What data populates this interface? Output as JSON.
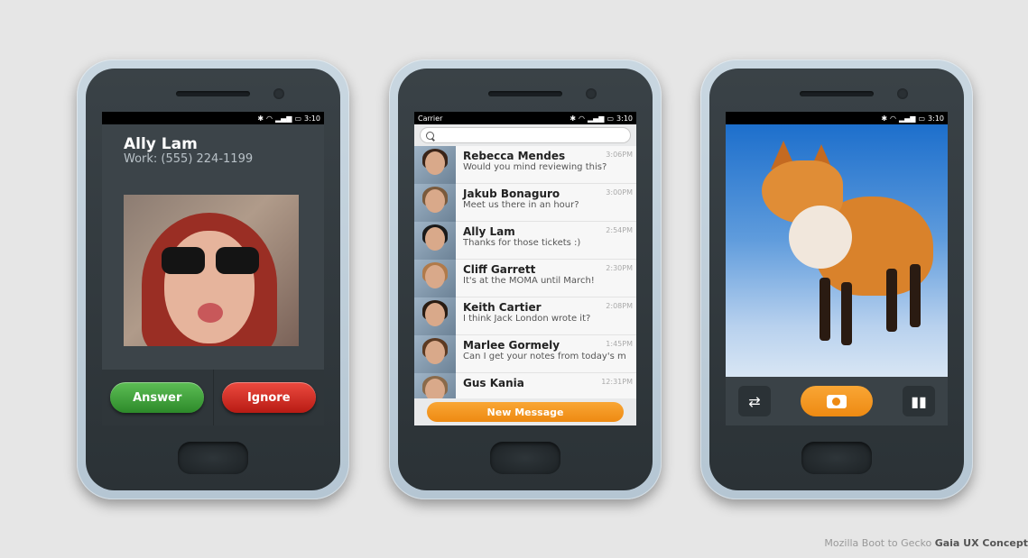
{
  "status": {
    "time": "3:10",
    "carrier": "Carrier",
    "icons": [
      "bluetooth-icon",
      "wifi-icon",
      "signal-icon",
      "battery-icon"
    ]
  },
  "call": {
    "caller_name": "Ally Lam",
    "caller_number": "Work: (555) 224-1199",
    "answer_label": "Answer",
    "ignore_label": "Ignore",
    "answer_color": "#2d8a2a",
    "ignore_color": "#b81b14"
  },
  "messages": {
    "items": [
      {
        "name": "Rebecca Mendes",
        "preview": "Would you mind reviewing this?",
        "time": "3:06PM"
      },
      {
        "name": "Jakub Bonaguro",
        "preview": "Meet us there in an hour?",
        "time": "3:00PM"
      },
      {
        "name": "Ally Lam",
        "preview": "Thanks for those tickets :)",
        "time": "2:54PM"
      },
      {
        "name": "Cliff Garrett",
        "preview": "It's at the MOMA until March!",
        "time": "2:30PM"
      },
      {
        "name": "Keith Cartier",
        "preview": "I think Jack London wrote it?",
        "time": "2:08PM"
      },
      {
        "name": "Marlee Gormely",
        "preview": "Can I get your notes from today's m",
        "time": "1:45PM"
      },
      {
        "name": "Gus Kania",
        "preview": "",
        "time": "12:31PM"
      }
    ],
    "new_message_label": "New Message",
    "accent_color": "#ee8a12"
  },
  "camera": {
    "switch_icon": "switch-camera-icon",
    "shutter_icon": "camera-icon",
    "mode_icon": "video-mode-icon"
  },
  "caption": {
    "prefix": "Mozilla Boot to Gecko ",
    "bold": "Gaia UX Concept"
  }
}
